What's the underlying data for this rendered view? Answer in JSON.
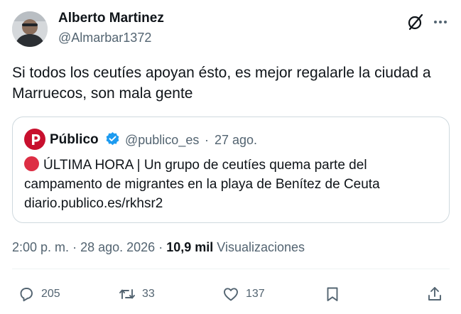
{
  "author": {
    "name": "Alberto Martinez",
    "handle": "@Almarbar1372"
  },
  "post": {
    "text": "Si todos los ceutíes apoyan ésto, es mejor regalarle la ciudad a Marruecos, son mala gente",
    "time": "2:00 p. m.",
    "date": "28 ago. 2026",
    "sep1": "·",
    "sep2": "·",
    "views_count": "10,9 mil",
    "views_label": "Visualizaciones"
  },
  "quote": {
    "name": "Público",
    "handle": "@publico_es",
    "dot": "·",
    "date": "27 ago.",
    "text": "ÚLTIMA HORA | Un grupo de ceutíes quema parte del campamento de migrantes en la playa de Benítez de Ceuta diario.publico.es/rkhsr2"
  },
  "actions": {
    "replies": "205",
    "reposts": "33",
    "likes": "137"
  },
  "colors": {
    "text": "#0f1419",
    "secondary": "#536471",
    "border": "#cfd9de",
    "verified": "#1d9bf0",
    "publico_red": "#c8102e",
    "alert_red": "#dd2e44"
  },
  "icons": [
    "grok-icon",
    "more-icon",
    "publico-logo",
    "verified-badge-icon",
    "red-circle-emoji",
    "reply-icon",
    "repost-icon",
    "like-icon",
    "bookmark-icon",
    "share-icon"
  ]
}
